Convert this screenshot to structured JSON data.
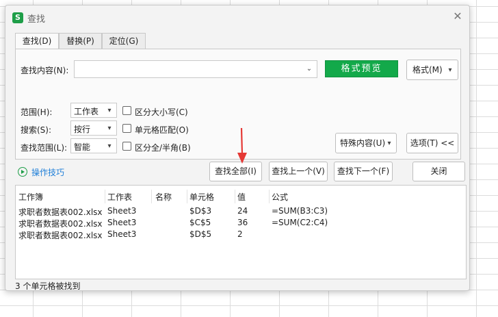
{
  "dialog": {
    "title": "查找",
    "app_icon_letter": "S",
    "close_glyph": "✕"
  },
  "tabs": [
    {
      "label": "查找(D)",
      "active": true
    },
    {
      "label": "替换(P)",
      "active": false
    },
    {
      "label": "定位(G)",
      "active": false
    }
  ],
  "find": {
    "label": "查找内容(N):",
    "value": "",
    "preview_button": "格式预览",
    "format_button": "格式(M)"
  },
  "options": {
    "scope_label": "范围(H):",
    "scope_value": "工作表",
    "search_label": "搜索(S):",
    "search_value": "按行",
    "lookin_label": "查找范围(L):",
    "lookin_value": "智能",
    "match_case": "区分大小写(C)",
    "match_cell": "单元格匹配(O)",
    "match_width": "区分全/半角(B)",
    "special_button": "特殊内容(U)",
    "options_button": "选项(T) <<"
  },
  "actions": {
    "tips": "操作技巧",
    "find_all": "查找全部(I)",
    "find_prev": "查找上一个(V)",
    "find_next": "查找下一个(F)",
    "close": "关闭"
  },
  "results": {
    "columns": [
      "工作簿",
      "工作表",
      "名称",
      "单元格",
      "值",
      "公式"
    ],
    "rows": [
      [
        "求职者数据表002.xlsx",
        "Sheet3",
        "",
        "$D$3",
        "24",
        "=SUM(B3:C3)"
      ],
      [
        "求职者数据表002.xlsx",
        "Sheet3",
        "",
        "$C$5",
        "36",
        "=SUM(C2:C4)"
      ],
      [
        "求职者数据表002.xlsx",
        "Sheet3",
        "",
        "$D$5",
        "2",
        ""
      ]
    ]
  },
  "status": "3 个单元格被找到",
  "colors": {
    "accent_green": "#13a94a",
    "link_blue": "#1f7fd8",
    "arrow_red": "#e53935"
  }
}
